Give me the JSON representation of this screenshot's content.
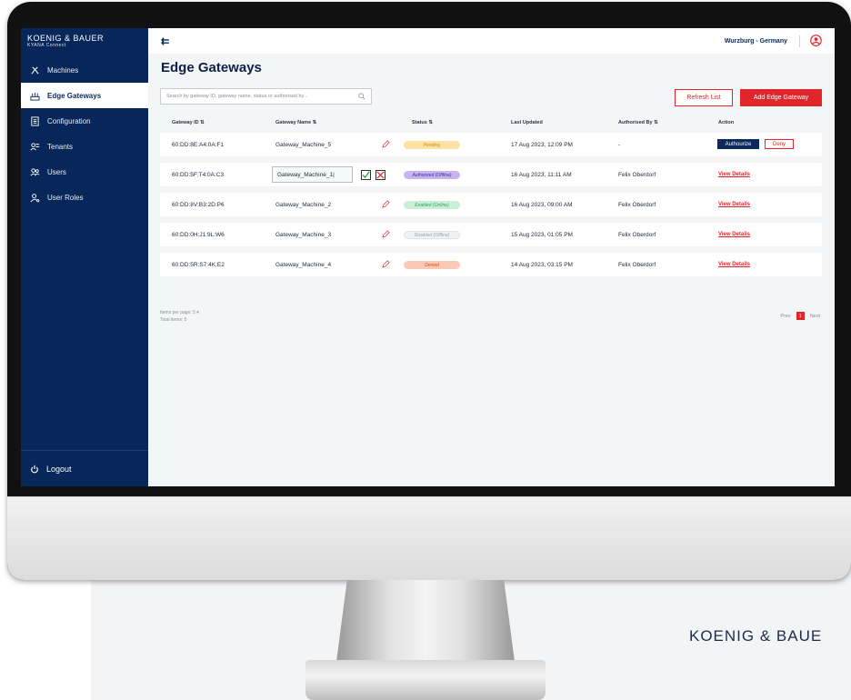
{
  "brand": {
    "name": "KOENIG & BAUER",
    "subtitle": "KYANA Connect"
  },
  "sidebar": {
    "items": [
      {
        "label": "Machines",
        "icon": "machines-icon",
        "active": false
      },
      {
        "label": "Edge Gateways",
        "icon": "gateway-icon",
        "active": true
      },
      {
        "label": "Configuration",
        "icon": "configuration-icon",
        "active": false
      },
      {
        "label": "Tenants",
        "icon": "tenants-icon",
        "active": false
      },
      {
        "label": "Users",
        "icon": "users-icon",
        "active": false
      },
      {
        "label": "User Roles",
        "icon": "user-roles-icon",
        "active": false
      }
    ],
    "logout_label": "Logout"
  },
  "topbar": {
    "menu_icon": "menu-collapse-icon",
    "location": "Wurzburg - Germany",
    "user_icon": "user-avatar-icon"
  },
  "page": {
    "title": "Edge Gateways",
    "search_placeholder": "Search by gateway ID, gateway name, status or authorised by...",
    "refresh_label": "Refresh List",
    "add_label": "Add Edge Gateway"
  },
  "table": {
    "headers": {
      "id": "Gateway ID ⇅",
      "name": "Gateway Name ⇅",
      "status": "Status ⇅",
      "updated": "Last Updated",
      "authorised": "Authorised By ⇅",
      "action": "Action"
    },
    "rows": [
      {
        "id": "60:DD:8E:A4:0A:F1",
        "name": "Gateway_Machine_5",
        "status": "Pending",
        "status_style": "pending",
        "updated": "17 Aug 2023, 12:09 PM",
        "authorised": "-",
        "authorize_label": "Authourize",
        "deny_label": "Deny"
      },
      {
        "id": "60:DD:5F:T4:0A:C3",
        "name": "Gateway_Machine_1|",
        "status": "Authorized (Offline)",
        "status_style": "auth",
        "updated": "16 Aug 2023, 11:11 AM",
        "authorised": "Felix Oberdorf",
        "action_label": "View Details"
      },
      {
        "id": "60:DD:8V:B3:2D:P6",
        "name": "Gateway_Machine_2",
        "status": "Enabled (Online)",
        "status_style": "enabled",
        "updated": "16 Aug 2023, 09:00 AM",
        "authorised": "Felix Oberdorf",
        "action_label": "View Details"
      },
      {
        "id": "60:DD:0H:J1:9L:W6",
        "name": "Gateway_Machine_3",
        "status": "Disabled (Offline)",
        "status_style": "disabled",
        "updated": "15 Aug 2023, 01:05 PM",
        "authorised": "Felix Oberdorf",
        "action_label": "View Details"
      },
      {
        "id": "60:DD:5R:S7:4K:E2",
        "name": "Gateway_Machine_4",
        "status": "Denied",
        "status_style": "denied",
        "updated": "14 Aug 2023, 03:15 PM",
        "authorised": "Felix Oberdorf",
        "action_label": "View Details"
      }
    ]
  },
  "footer": {
    "items_per_page": "Items per page:  5 ▾",
    "total_items": "Total items: 5",
    "prev": "Prev",
    "current_page": "1",
    "next": "Next"
  },
  "corner_logo": "KOENIG & BAUE",
  "colors": {
    "sidebar": "#07275a",
    "accent": "#e0262b",
    "background": "#f4f5f7"
  }
}
